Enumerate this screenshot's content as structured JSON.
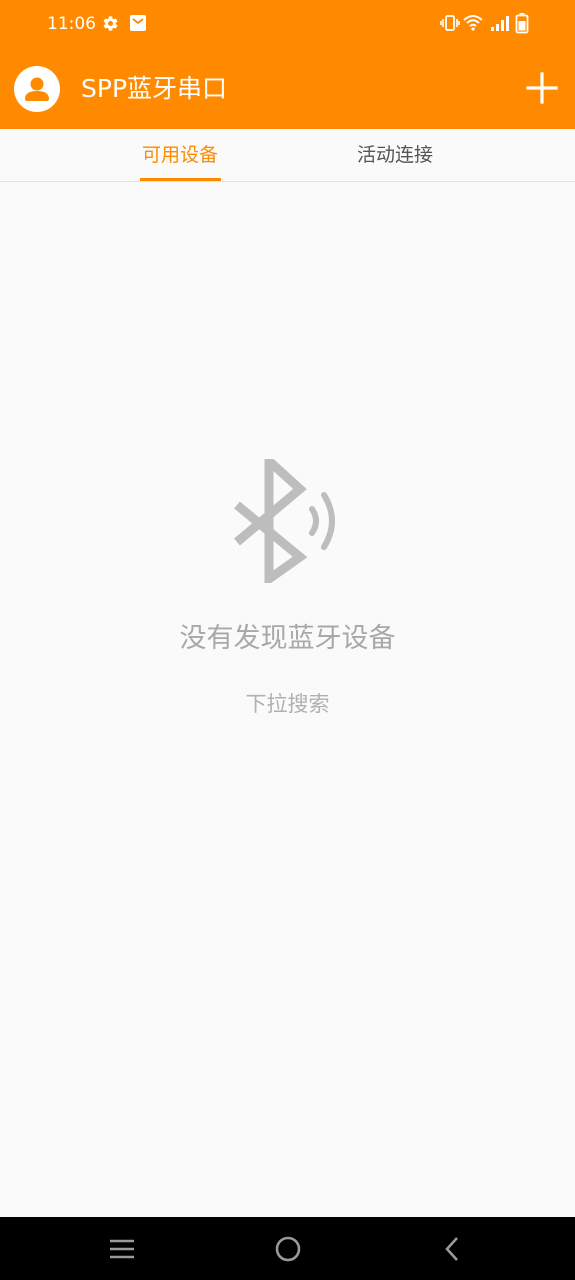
{
  "status_bar": {
    "time": "11:06",
    "icons": [
      "settings-gear-icon",
      "mail-notification-icon",
      "vibrate-icon",
      "wifi-icon",
      "cellular-signal-icon",
      "battery-icon"
    ]
  },
  "toolbar": {
    "title": "SPP蓝牙串口",
    "avatar_icon": "user-avatar-icon",
    "add_icon": "plus-icon"
  },
  "tabs": [
    {
      "label": "可用设备",
      "selected": true
    },
    {
      "label": "活动连接",
      "selected": false
    }
  ],
  "empty_state": {
    "icon": "bluetooth-icon",
    "title": "没有发现蓝牙设备",
    "hint": "下拉搜索"
  },
  "nav_bar": {
    "icons": [
      "menu-icon",
      "home-icon",
      "back-icon"
    ]
  },
  "colors": {
    "primary": "#ff8a00",
    "background": "#fafafa",
    "tab_inactive": "#555555",
    "empty_text": "#a8a8a8",
    "nav_background": "#000000"
  }
}
